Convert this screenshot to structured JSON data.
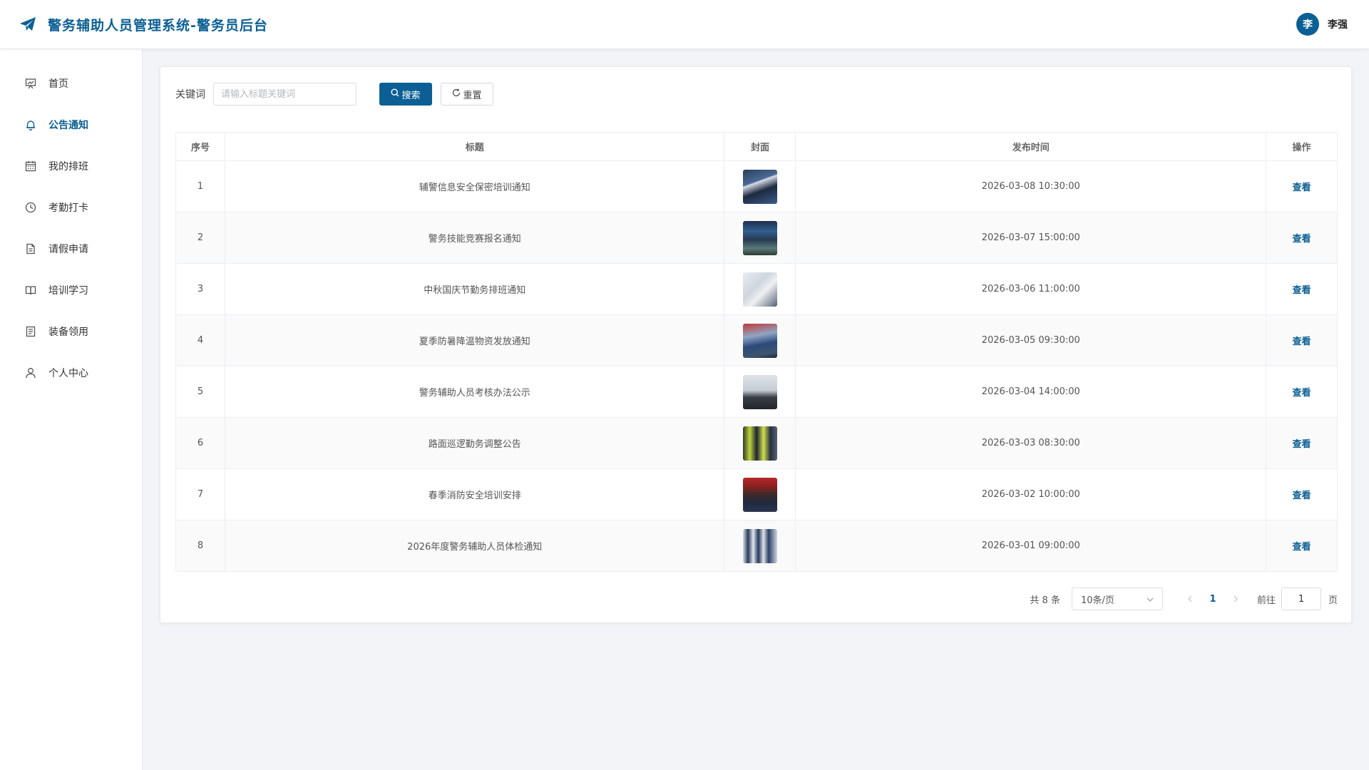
{
  "header": {
    "title": "警务辅助人员管理系统-警务员后台",
    "user": {
      "avatar_char": "李",
      "name": "李强"
    }
  },
  "sidebar": {
    "items": [
      {
        "label": "首页",
        "icon": "dashboard-icon",
        "active": false
      },
      {
        "label": "公告通知",
        "icon": "bell-icon",
        "active": true
      },
      {
        "label": "我的排班",
        "icon": "calendar-icon",
        "active": false
      },
      {
        "label": "考勤打卡",
        "icon": "clock-icon",
        "active": false
      },
      {
        "label": "请假申请",
        "icon": "document-icon",
        "active": false
      },
      {
        "label": "培训学习",
        "icon": "book-icon",
        "active": false
      },
      {
        "label": "装备领用",
        "icon": "list-icon",
        "active": false
      },
      {
        "label": "个人中心",
        "icon": "user-icon",
        "active": false
      }
    ]
  },
  "filter": {
    "keyword_label": "关键词",
    "keyword_value": "",
    "keyword_placeholder": "请输入标题关键词",
    "search_label": "搜索",
    "reset_label": "重置"
  },
  "table": {
    "columns": [
      "序号",
      "标题",
      "封面",
      "发布时间",
      "操作"
    ],
    "rows": [
      {
        "index": "1",
        "title": "辅警信息安全保密培训通知",
        "cover": "training-photo",
        "time": "2026-03-08 10:30:00",
        "action": "查看"
      },
      {
        "index": "2",
        "title": "警务技能竞赛报名通知",
        "cover": "competition-photo",
        "time": "2026-03-07 15:00:00",
        "action": "查看"
      },
      {
        "index": "3",
        "title": "中秋国庆节勤务排班通知",
        "cover": "schedule-photo",
        "time": "2026-03-06 11:00:00",
        "action": "查看"
      },
      {
        "index": "4",
        "title": "夏季防暑降温物资发放通知",
        "cover": "supplies-photo",
        "time": "2026-03-05 09:30:00",
        "action": "查看"
      },
      {
        "index": "5",
        "title": "警务辅助人员考核办法公示",
        "cover": "assessment-photo",
        "time": "2026-03-04 14:00:00",
        "action": "查看"
      },
      {
        "index": "6",
        "title": "路面巡逻勤务调整公告",
        "cover": "patrol-photo",
        "time": "2026-03-03 08:30:00",
        "action": "查看"
      },
      {
        "index": "7",
        "title": "春季消防安全培训安排",
        "cover": "fire-training-photo",
        "time": "2026-03-02 10:00:00",
        "action": "查看"
      },
      {
        "index": "8",
        "title": "2026年度警务辅助人员体检通知",
        "cover": "checkup-photo",
        "time": "2026-03-01 09:00:00",
        "action": "查看"
      }
    ]
  },
  "pagination": {
    "total_text": "共 8 条",
    "page_size": "10条/页",
    "current_page": "1",
    "goto_label": "前往",
    "goto_value": "1",
    "goto_suffix": "页"
  },
  "colors": {
    "primary": "#0b5f94",
    "background": "#f2f4f7"
  }
}
